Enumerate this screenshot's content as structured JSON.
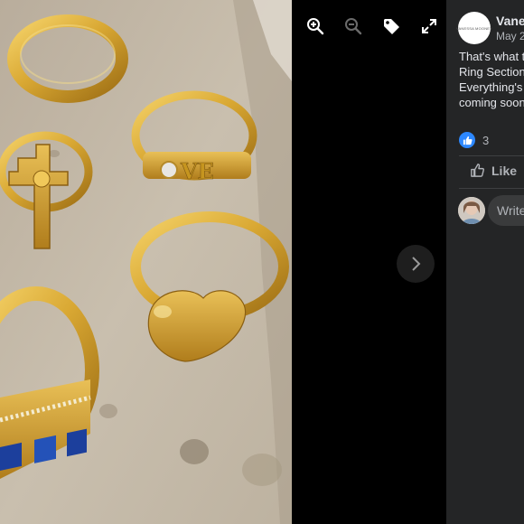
{
  "viewer": {
    "toolbar": [
      {
        "icon": "zoom-in-icon"
      },
      {
        "icon": "zoom-out-icon"
      },
      {
        "icon": "tag-icon"
      },
      {
        "icon": "fullscreen-icon"
      }
    ],
    "next_icon": "chevron-right-icon"
  },
  "post": {
    "author_avatar_text": "VANESSA MOONEY",
    "author": "Vane",
    "date": "May 2",
    "text_lines": [
      "That's what t",
      "Ring Section",
      "Everything's",
      "coming soon"
    ],
    "reaction_count": "3",
    "like_label": "Like",
    "comment_placeholder": "Write"
  },
  "colors": {
    "panel_bg": "#242526",
    "viewer_bg": "#000000",
    "like_blue": "#2d88ff",
    "text_primary": "#e4e6eb",
    "text_secondary": "#b0b3b8",
    "comment_bg": "#3a3b3c"
  }
}
